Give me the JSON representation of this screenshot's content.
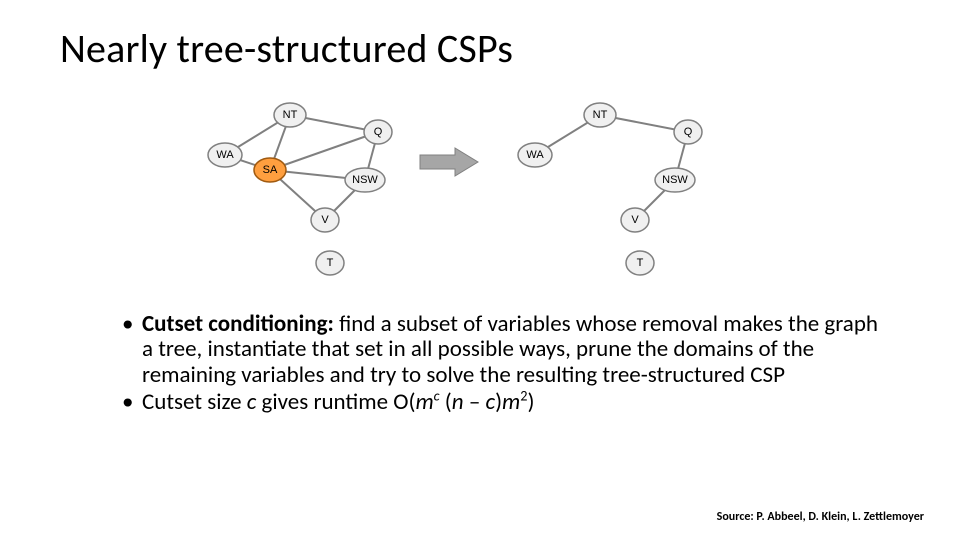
{
  "title": "Nearly tree-structured CSPs",
  "graphs": {
    "left": {
      "nodes": {
        "WA": "WA",
        "NT": "NT",
        "SA": "SA",
        "Q": "Q",
        "NSW": "NSW",
        "V": "V",
        "T": "T"
      },
      "highlight": "SA"
    },
    "right": {
      "nodes": {
        "WA": "WA",
        "NT": "NT",
        "Q": "Q",
        "NSW": "NSW",
        "V": "V",
        "T": "T"
      }
    }
  },
  "bullets": {
    "b1_lead_bold": "Cutset conditioning:",
    "b1_rest": " find a subset of variables whose removal makes the graph a tree, instantiate that set in all possible ways, prune the domains of the remaining variables and try to solve the resulting tree-structured CSP",
    "b2_p1": "Cutset size ",
    "b2_c": "c",
    "b2_p2": " gives runtime O(",
    "b2_m1": "m",
    "b2_sup_c": "c",
    "b2_sp": " (",
    "b2_n": "n",
    "b2_mid": " – ",
    "b2_c2": "c",
    "b2_p3": ")",
    "b2_m2": "m",
    "b2_sup_2": "2",
    "b2_p4": ")"
  },
  "source": "Source: P. Abbeel, D. Klein, L. Zettlemoyer",
  "chart_data": [
    {
      "type": "graph",
      "name": "original-constraint-graph",
      "nodes": [
        "WA",
        "NT",
        "SA",
        "Q",
        "NSW",
        "V",
        "T"
      ],
      "highlighted": [
        "SA"
      ],
      "edges": [
        [
          "WA",
          "NT"
        ],
        [
          "WA",
          "SA"
        ],
        [
          "NT",
          "SA"
        ],
        [
          "NT",
          "Q"
        ],
        [
          "SA",
          "Q"
        ],
        [
          "SA",
          "NSW"
        ],
        [
          "SA",
          "V"
        ],
        [
          "Q",
          "NSW"
        ],
        [
          "NSW",
          "V"
        ]
      ],
      "disconnected": [
        "T"
      ]
    },
    {
      "type": "graph",
      "name": "after-removing-cutset",
      "removed": [
        "SA"
      ],
      "nodes": [
        "WA",
        "NT",
        "Q",
        "NSW",
        "V",
        "T"
      ],
      "edges": [
        [
          "WA",
          "NT"
        ],
        [
          "NT",
          "Q"
        ],
        [
          "Q",
          "NSW"
        ],
        [
          "NSW",
          "V"
        ]
      ],
      "disconnected": [
        "T"
      ]
    }
  ]
}
